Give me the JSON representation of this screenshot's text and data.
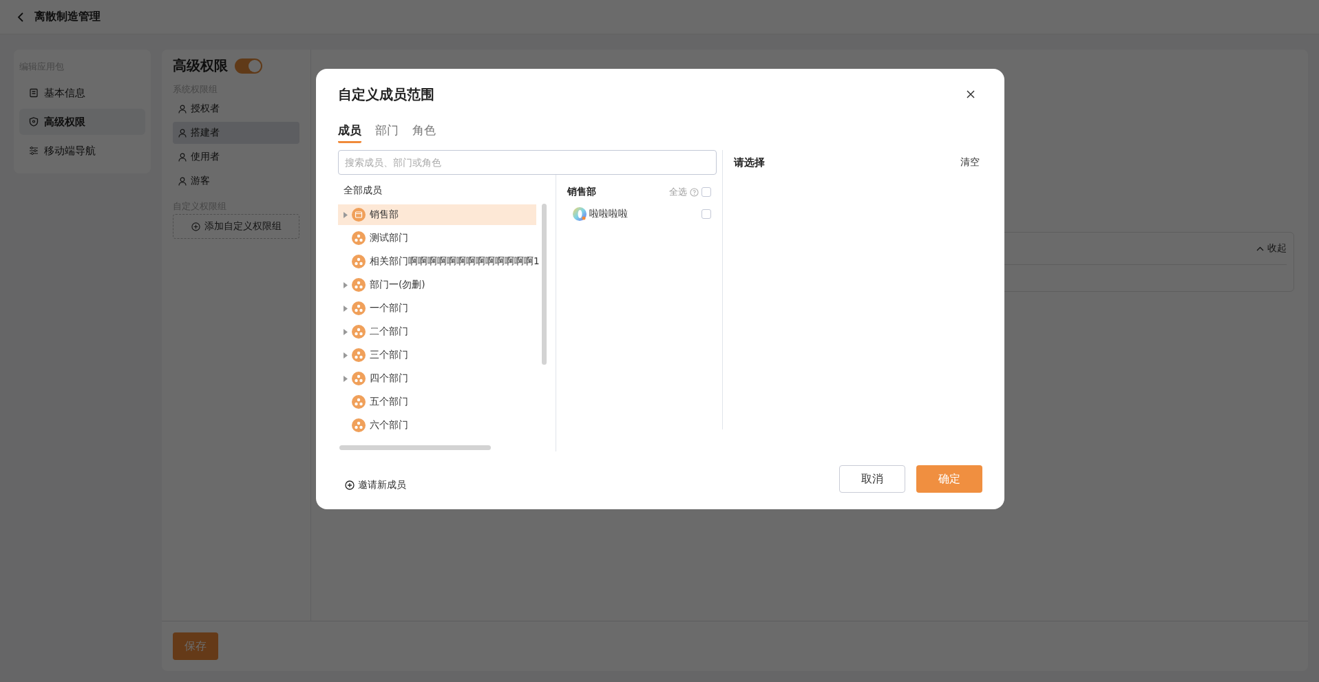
{
  "header": {
    "title": "离散制造管理"
  },
  "sidebar": {
    "heading": "编辑应用包",
    "items": [
      {
        "label": "基本信息",
        "kind": "document",
        "selected": false
      },
      {
        "label": "高级权限",
        "kind": "shield",
        "selected": true
      },
      {
        "label": "移动端导航",
        "kind": "sliders",
        "selected": false
      }
    ]
  },
  "permissions": {
    "title": "高级权限",
    "enabled": true,
    "system_heading": "系统权限组",
    "groups": [
      {
        "label": "授权者",
        "selected": false
      },
      {
        "label": "搭建者",
        "selected": true
      },
      {
        "label": "使用者",
        "selected": false
      },
      {
        "label": "游客",
        "selected": false
      }
    ],
    "custom_heading": "自定义权限组",
    "add_button": "添加自定义权限组"
  },
  "panel": {
    "collapse_label": "收起"
  },
  "save_button": "保存",
  "dialog": {
    "title": "自定义成员范围",
    "tabs": [
      {
        "label": "成员",
        "selected": true
      },
      {
        "label": "部门",
        "selected": false
      },
      {
        "label": "角色",
        "selected": false
      }
    ],
    "search": {
      "placeholder": "搜索成员、部门或角色"
    },
    "tree": {
      "root": "全部成员",
      "items": [
        {
          "label": "销售部",
          "kind": "company",
          "expandable": true,
          "selected": true
        },
        {
          "label": "测试部门",
          "kind": "department",
          "expandable": false,
          "selected": false
        },
        {
          "label": "相关部门啊啊啊啊啊啊啊啊啊啊啊啊啊1",
          "kind": "department",
          "expandable": false,
          "selected": false
        },
        {
          "label": "部门一(勿删)",
          "kind": "department",
          "expandable": true,
          "selected": false
        },
        {
          "label": "一个部门",
          "kind": "department",
          "expandable": true,
          "selected": false
        },
        {
          "label": "二个部门",
          "kind": "department",
          "expandable": true,
          "selected": false
        },
        {
          "label": "三个部门",
          "kind": "department",
          "expandable": true,
          "selected": false
        },
        {
          "label": "四个部门",
          "kind": "department",
          "expandable": true,
          "selected": false
        },
        {
          "label": "五个部门",
          "kind": "department",
          "expandable": false,
          "selected": false
        },
        {
          "label": "六个部门",
          "kind": "department",
          "expandable": false,
          "selected": false
        }
      ]
    },
    "members": {
      "heading": "销售部",
      "select_all": "全选",
      "select_all_checked": false,
      "items": [
        {
          "name": "啦啦啦啦",
          "checked": false
        }
      ]
    },
    "selected_panel": {
      "heading": "请选择",
      "clear": "清空"
    },
    "invite": "邀请新成员",
    "cancel": "取消",
    "confirm": "确定"
  }
}
